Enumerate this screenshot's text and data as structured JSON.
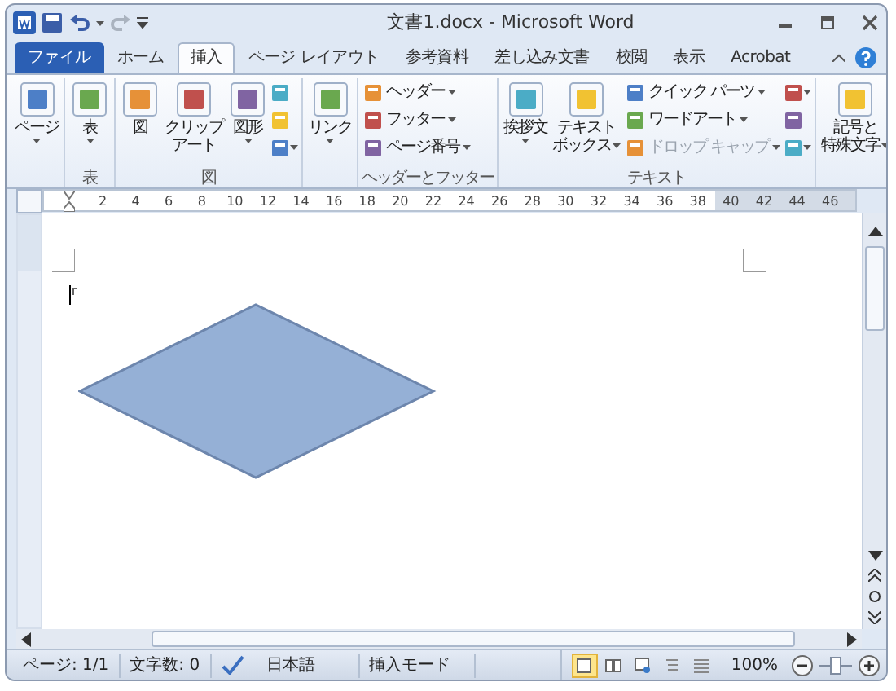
{
  "window": {
    "title": "文書1.docx - Microsoft Word"
  },
  "quick_access": [
    {
      "kind": "save",
      "disabled": false
    },
    {
      "kind": "undo",
      "disabled": false
    },
    {
      "kind": "redo",
      "disabled": true
    }
  ],
  "tabs": [
    {
      "label": "ファイル",
      "kind": "file",
      "selected": false
    },
    {
      "label": "ホーム",
      "kind": "tab",
      "selected": false
    },
    {
      "label": "挿入",
      "kind": "tab",
      "selected": true
    },
    {
      "label": "ページ レイアウト",
      "kind": "tab",
      "selected": false
    },
    {
      "label": "参考資料",
      "kind": "tab",
      "selected": false
    },
    {
      "label": "差し込み文書",
      "kind": "tab",
      "selected": false
    },
    {
      "label": "校閲",
      "kind": "tab",
      "selected": false
    },
    {
      "label": "表示",
      "kind": "tab",
      "selected": false
    },
    {
      "label": "Acrobat",
      "kind": "tab",
      "selected": false
    }
  ],
  "ribbon": {
    "groups": [
      {
        "items": [
          {
            "kind": "large",
            "label": "ページ",
            "menu": true
          }
        ]
      },
      {
        "label": "表",
        "items": [
          {
            "kind": "large",
            "label": "表",
            "menu": true
          }
        ]
      },
      {
        "label": "図",
        "items": [
          {
            "kind": "large",
            "label": "図",
            "menu": false
          },
          {
            "kind": "large",
            "lines": [
              "クリップ",
              "アート"
            ],
            "menu": false
          },
          {
            "kind": "large",
            "label": "図形",
            "menu": true
          },
          {
            "kind": "stack",
            "items": [
              {
                "menu": false
              },
              {
                "menu": false
              },
              {
                "menu": true
              }
            ]
          }
        ]
      },
      {
        "items": [
          {
            "kind": "large",
            "label": "リンク",
            "menu": true
          }
        ]
      },
      {
        "label": "ヘッダーとフッター",
        "items": [
          {
            "kind": "column",
            "items": [
              {
                "label": "ヘッダー",
                "menu": true,
                "disabled": false
              },
              {
                "label": "フッター",
                "menu": true,
                "disabled": false
              },
              {
                "label": "ページ番号",
                "menu": true,
                "disabled": false
              }
            ]
          }
        ]
      },
      {
        "label": "テキスト",
        "items": [
          {
            "kind": "large",
            "label": "挨拶文",
            "menu": true
          },
          {
            "kind": "large",
            "lines": [
              "テキスト",
              "ボックス"
            ],
            "menu": true
          },
          {
            "kind": "column",
            "items": [
              {
                "label": "クイック パーツ",
                "menu": true,
                "disabled": false
              },
              {
                "label": "ワードアート",
                "menu": true,
                "disabled": false
              },
              {
                "label": "ドロップ キャップ",
                "menu": true,
                "disabled": true
              }
            ]
          },
          {
            "kind": "stack",
            "items": [
              {
                "menu": true
              },
              {
                "menu": false
              },
              {
                "menu": true
              }
            ]
          }
        ]
      },
      {
        "items": [
          {
            "kind": "large",
            "lines": [
              "記号と",
              "特殊文字"
            ],
            "menu": true
          }
        ]
      }
    ]
  },
  "ruler": {
    "labels": [
      "2",
      "4",
      "6",
      "8",
      "10",
      "12",
      "14",
      "16",
      "18",
      "20",
      "22",
      "24",
      "26",
      "28",
      "30",
      "32",
      "34",
      "36",
      "38",
      "40",
      "42",
      "44",
      "46"
    ]
  },
  "status_bar": {
    "page": "ページ: 1/1",
    "words": "文字数: 0",
    "language": "日本語",
    "mode": "挿入モード",
    "views": [
      {
        "kind": "print",
        "selected": true
      },
      {
        "kind": "read",
        "selected": false
      },
      {
        "kind": "web",
        "selected": false
      },
      {
        "kind": "outline",
        "selected": false
      },
      {
        "kind": "draft",
        "selected": false
      }
    ],
    "zoom": "100%",
    "zoom_slider": {
      "level": 0.5
    }
  }
}
